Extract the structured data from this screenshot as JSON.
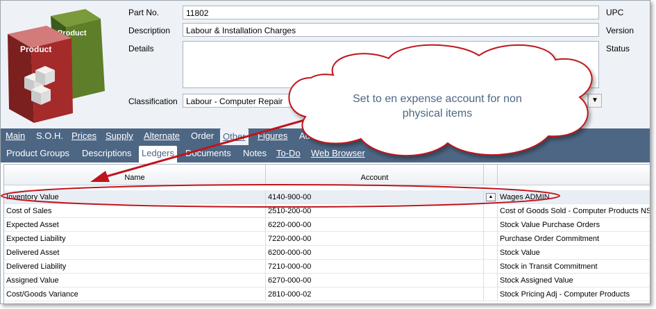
{
  "header": {
    "part_no_label": "Part No.",
    "part_no_value": "11802",
    "description_label": "Description",
    "description_value": "Labour & Installation Charges",
    "details_label": "Details",
    "classification_label": "Classification",
    "classification_value": "Labour - Computer Repair",
    "upc_label": "UPC",
    "version_label": "Version",
    "status_label": "Status"
  },
  "product_art": {
    "front_label": "Product",
    "back_label": "Product"
  },
  "tabs_row1": [
    "Main",
    "S.O.H.",
    "Prices",
    "Supply",
    "Alternate",
    "Order",
    "Other",
    "Figures",
    "Add"
  ],
  "tabs_row2": [
    "Product Groups",
    "Descriptions",
    "Ledgers",
    "Documents",
    "Notes",
    "To-Do",
    "Web Browser"
  ],
  "grid": {
    "columns": [
      "Name",
      "Account",
      ""
    ],
    "rows": [
      {
        "name": "Inventory Value",
        "account": "4140-900-00",
        "desc": "Wages ADMIN"
      },
      {
        "name": "Cost of Sales",
        "account": "2510-200-00",
        "desc": "Cost of Goods Sold - Computer Products NSW"
      },
      {
        "name": "Expected Asset",
        "account": "6220-000-00",
        "desc": "Stock Value Purchase Orders"
      },
      {
        "name": "Expected Liability",
        "account": "7220-000-00",
        "desc": "Purchase Order Commitment"
      },
      {
        "name": "Delivered Asset",
        "account": "6200-000-00",
        "desc": "Stock Value"
      },
      {
        "name": "Delivered Liability",
        "account": "7210-000-00",
        "desc": "Stock in Transit Commitment"
      },
      {
        "name": "Assigned Value",
        "account": "6270-000-00",
        "desc": "Stock Assigned Value"
      },
      {
        "name": "Cost/Goods Variance",
        "account": "2810-000-02",
        "desc": "Stock Pricing Adj - Computer Products"
      }
    ]
  },
  "callout": {
    "line1": "Set to en expense account for non",
    "line2": "physical items"
  },
  "colors": {
    "tab_bar": "#4d6684",
    "annotation_red": "#c0141b",
    "header_bg": "#eef2f7"
  }
}
